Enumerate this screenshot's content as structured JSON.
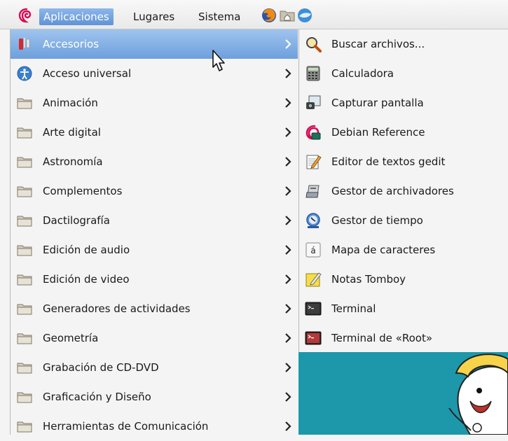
{
  "panel": {
    "applications": "Aplicaciones",
    "places": "Lugares",
    "system": "Sistema",
    "launchers": [
      "firefox-icon",
      "home-folder-icon",
      "thunderbird-icon"
    ]
  },
  "menu": {
    "items": [
      {
        "label": "Accesorios",
        "icon": "accessories-icon",
        "active": true
      },
      {
        "label": "Acceso universal",
        "icon": "universal-access-icon"
      },
      {
        "label": "Animación",
        "icon": "folder-icon"
      },
      {
        "label": "Arte digital",
        "icon": "folder-icon"
      },
      {
        "label": "Astronomía",
        "icon": "folder-icon"
      },
      {
        "label": "Complementos",
        "icon": "folder-icon"
      },
      {
        "label": "Dactilografía",
        "icon": "folder-icon"
      },
      {
        "label": "Edición de audio",
        "icon": "folder-icon"
      },
      {
        "label": "Edición de video",
        "icon": "folder-icon"
      },
      {
        "label": "Generadores de actividades",
        "icon": "folder-icon"
      },
      {
        "label": "Geometría",
        "icon": "folder-icon"
      },
      {
        "label": "Grabación de CD-DVD",
        "icon": "folder-icon"
      },
      {
        "label": "Graficación y Diseño",
        "icon": "folder-icon"
      },
      {
        "label": "Herramientas de Comunicación",
        "icon": "folder-icon"
      }
    ]
  },
  "submenu": {
    "items": [
      {
        "label": "Buscar archivos...",
        "icon": "search-icon"
      },
      {
        "label": "Calculadora",
        "icon": "calculator-icon"
      },
      {
        "label": "Capturar pantalla",
        "icon": "screenshot-icon"
      },
      {
        "label": "Debian Reference",
        "icon": "debian-reference-icon"
      },
      {
        "label": "Editor de textos gedit",
        "icon": "text-editor-icon"
      },
      {
        "label": "Gestor de archivadores",
        "icon": "archive-manager-icon"
      },
      {
        "label": "Gestor de tiempo",
        "icon": "time-tracker-icon"
      },
      {
        "label": "Mapa de caracteres",
        "icon": "character-map-icon",
        "glyph": "á"
      },
      {
        "label": "Notas Tomboy",
        "icon": "tomboy-notes-icon"
      },
      {
        "label": "Terminal",
        "icon": "terminal-icon"
      },
      {
        "label": "Terminal de «Root»",
        "icon": "root-terminal-icon"
      }
    ]
  },
  "colors": {
    "highlight": "#6d9fdc",
    "desktop": "#1d98ab",
    "menu_bg": "#f4f4f4"
  }
}
